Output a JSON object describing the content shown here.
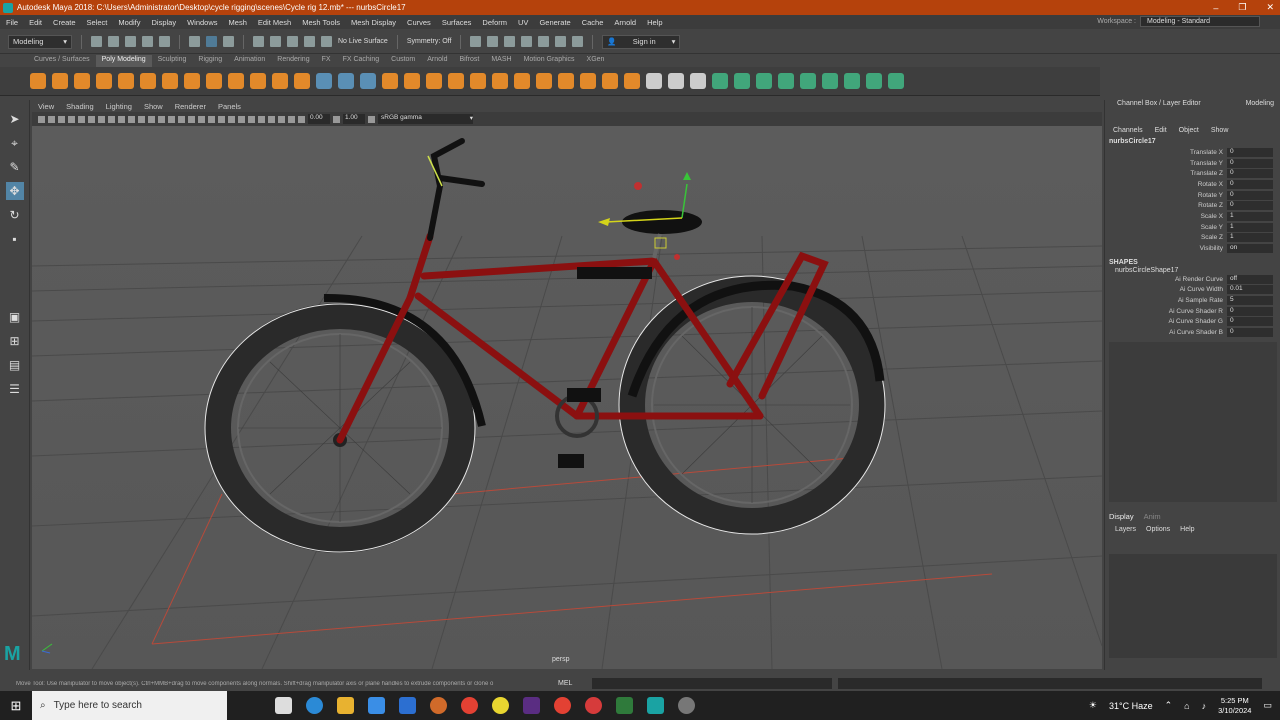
{
  "window": {
    "title": "Autodesk Maya 2018: C:\\Users\\Administrator\\Desktop\\cycle rigging\\scenes\\Cycle rig 12.mb*  ---  nurbsCircle17",
    "controls": [
      "–",
      "❐",
      "✕"
    ]
  },
  "menus": [
    "File",
    "Edit",
    "Create",
    "Select",
    "Modify",
    "Display",
    "Windows",
    "Mesh",
    "Edit Mesh",
    "Mesh Tools",
    "Mesh Display",
    "Curves",
    "Surfaces",
    "Deform",
    "UV",
    "Generate",
    "Cache",
    "Arnold",
    "Help"
  ],
  "workspace": {
    "label": "Workspace :",
    "value": "Modeling - Standard"
  },
  "statusline": {
    "mode": "Modeling",
    "live_surface": "No Live Surface",
    "symmetry": "Symmetry: Off",
    "sign_in": "Sign in"
  },
  "shelf_tabs": [
    "Curves / Surfaces",
    "Poly Modeling",
    "Sculpting",
    "Rigging",
    "Animation",
    "Rendering",
    "FX",
    "FX Caching",
    "Custom",
    "Arnold",
    "Bifrost",
    "MASH",
    "Motion Graphics",
    "XGen"
  ],
  "shelf_active_tab": "Poly Modeling",
  "panel_menus": [
    "View",
    "Shading",
    "Lighting",
    "Show",
    "Renderer",
    "Panels"
  ],
  "panel_toolbar": {
    "exposure": "0.00",
    "gamma": "1.00",
    "color_space": "sRGB gamma"
  },
  "viewport": {
    "camera_label": "persp"
  },
  "channel_box": {
    "header": "Channel Box / Layer Editor",
    "header_right": "Modeling",
    "menu": [
      "Channels",
      "Edit",
      "Object",
      "Show"
    ],
    "node": "nurbsCircle17",
    "attributes": [
      {
        "label": "Translate X",
        "value": "0"
      },
      {
        "label": "Translate Y",
        "value": "0"
      },
      {
        "label": "Translate Z",
        "value": "0"
      },
      {
        "label": "Rotate X",
        "value": "0"
      },
      {
        "label": "Rotate Y",
        "value": "0"
      },
      {
        "label": "Rotate Z",
        "value": "0"
      },
      {
        "label": "Scale X",
        "value": "1"
      },
      {
        "label": "Scale Y",
        "value": "1"
      },
      {
        "label": "Scale Z",
        "value": "1"
      },
      {
        "label": "Visibility",
        "value": "on"
      }
    ],
    "shapes_header": "SHAPES",
    "shape_node": "nurbsCircleShape17",
    "shape_attributes": [
      {
        "label": "Ai Render Curve",
        "value": "off"
      },
      {
        "label": "Ai Curve Width",
        "value": "0.01"
      },
      {
        "label": "Ai Sample Rate",
        "value": "5"
      },
      {
        "label": "Ai Curve Shader R",
        "value": "0"
      },
      {
        "label": "Ai Curve Shader G",
        "value": "0"
      },
      {
        "label": "Ai Curve Shader B",
        "value": "0"
      }
    ]
  },
  "layer_editor": {
    "tabs": [
      "Display",
      "Anim"
    ],
    "menu": [
      "Layers",
      "Options",
      "Help"
    ]
  },
  "help_line": "Move Tool: Use manipulator to move object(s). Ctrl+MMB+drag to move components along normals. Shift+drag manipulator axis or plane handles to extrude components or clone o",
  "command_line": {
    "label": "MEL"
  },
  "taskbar": {
    "search_placeholder": "Type here to search",
    "weather": "31°C  Haze",
    "time": "5:25 PM",
    "date": "3/10/2024"
  },
  "colors": {
    "title_bar": "#b5420c",
    "bike_frame": "#8b1010",
    "selection": "#5285a6",
    "maya_teal": "#1aa3a3"
  }
}
